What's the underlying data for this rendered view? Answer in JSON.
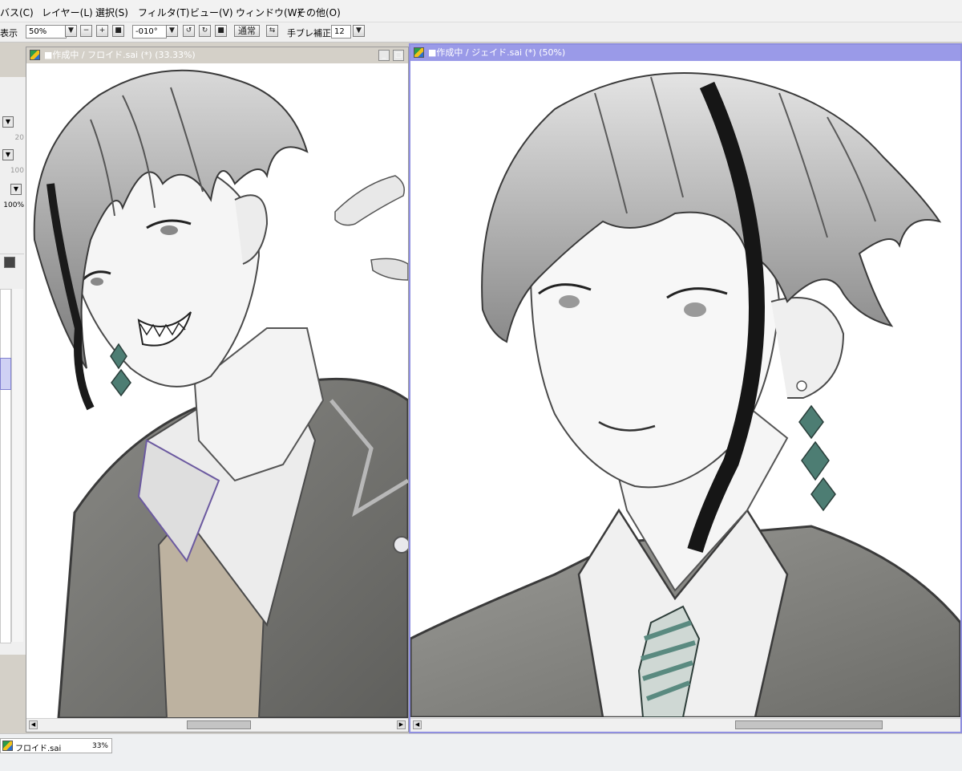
{
  "menu": [
    "バス(C)",
    "レイヤー(L)",
    "選択(S)",
    "フィルタ(T)",
    "ビュー(V)",
    "ウィンドウ(W)",
    "その他(O)"
  ],
  "toolbar": {
    "view_label": "表示",
    "zoom": "50%",
    "angle": "-010°",
    "blend_mode": "通常",
    "stabilizer_label": "手ブレ補正",
    "stabilizer_value": "12"
  },
  "left_panel": {
    "values": [
      "20",
      "100",
      "100%"
    ]
  },
  "windows": {
    "floyd": {
      "title": "■作成中 / フロイド.sai (*) (33.33%)",
      "zoom": "33.33%"
    },
    "jade": {
      "title": "■作成中 / ジェイド.sai (*) (50%)",
      "zoom": "50%"
    }
  },
  "taskbar": {
    "file": "フロイド.sai",
    "zoom": "33%"
  },
  "colors": {
    "active_titlebar": "#9a9ae8",
    "inactive_titlebar": "#d4d0c8",
    "active_border": "#8f8fe0",
    "earring": "#4d7d73",
    "tie_stripe": "#5a8a80"
  },
  "icons": [
    "app-icon",
    "minimize-icon",
    "maximize-icon",
    "dropdown-arrow-icon",
    "zoom-in-icon",
    "zoom-out-icon",
    "reset-icon",
    "rotate-left-icon",
    "rotate-right-icon",
    "mirror-icon",
    "scroll-left-icon",
    "scroll-right-icon"
  ]
}
